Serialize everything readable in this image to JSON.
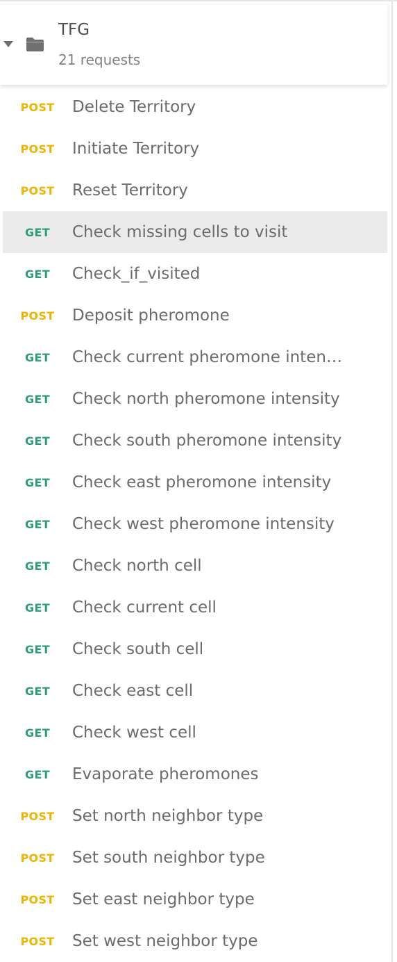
{
  "collection": {
    "name": "TFG",
    "meta": "21 requests",
    "icon": "folder-icon",
    "caret_icon": "caret-down-icon"
  },
  "colors": {
    "get": "#2d9d78",
    "post": "#f0b400",
    "selected_bg": "#ebebeb"
  },
  "requests": [
    {
      "method": "POST",
      "name": "Delete Territory",
      "selected": false
    },
    {
      "method": "POST",
      "name": "Initiate Territory",
      "selected": false
    },
    {
      "method": "POST",
      "name": "Reset Territory",
      "selected": false
    },
    {
      "method": "GET",
      "name": "Check missing cells to visit",
      "selected": true
    },
    {
      "method": "GET",
      "name": "Check_if_visited",
      "selected": false
    },
    {
      "method": "POST",
      "name": "Deposit pheromone",
      "selected": false
    },
    {
      "method": "GET",
      "name": "Check current pheromone intens...",
      "selected": false
    },
    {
      "method": "GET",
      "name": "Check north pheromone intensity",
      "selected": false
    },
    {
      "method": "GET",
      "name": "Check south pheromone intensity",
      "selected": false
    },
    {
      "method": "GET",
      "name": "Check east pheromone intensity",
      "selected": false
    },
    {
      "method": "GET",
      "name": "Check west pheromone intensity",
      "selected": false
    },
    {
      "method": "GET",
      "name": "Check north cell",
      "selected": false
    },
    {
      "method": "GET",
      "name": "Check current cell",
      "selected": false
    },
    {
      "method": "GET",
      "name": "Check south cell",
      "selected": false
    },
    {
      "method": "GET",
      "name": "Check east cell",
      "selected": false
    },
    {
      "method": "GET",
      "name": "Check west cell",
      "selected": false
    },
    {
      "method": "GET",
      "name": "Evaporate pheromones",
      "selected": false
    },
    {
      "method": "POST",
      "name": "Set north neighbor type",
      "selected": false
    },
    {
      "method": "POST",
      "name": "Set south neighbor type",
      "selected": false
    },
    {
      "method": "POST",
      "name": "Set east neighbor type",
      "selected": false
    },
    {
      "method": "POST",
      "name": "Set west neighbor type",
      "selected": false
    }
  ]
}
